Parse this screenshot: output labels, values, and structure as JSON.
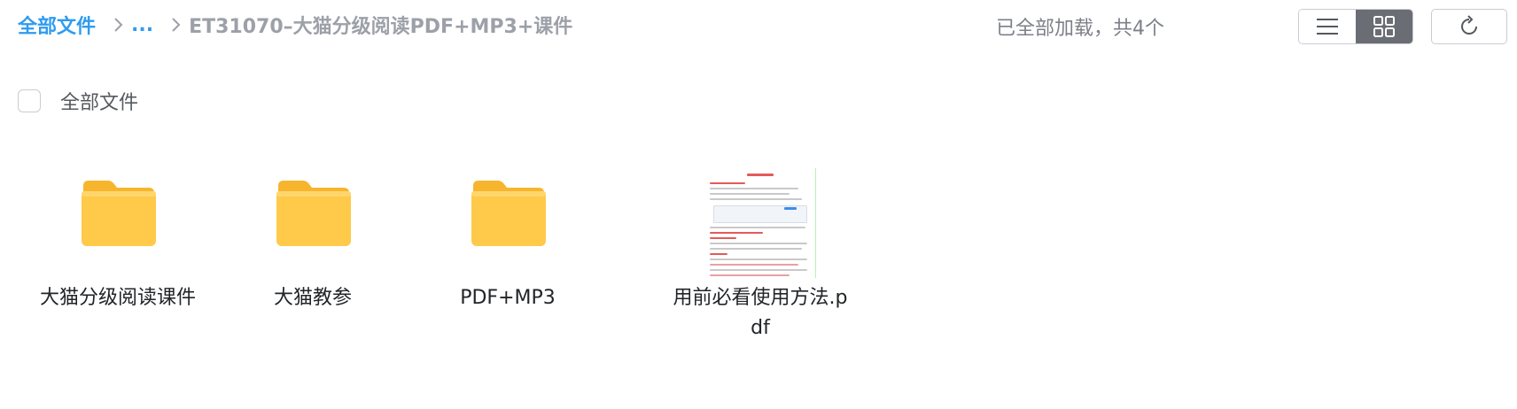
{
  "breadcrumb": {
    "root": "全部文件",
    "ellipsis": "...",
    "current": "ET31070–大猫分级阅读PDF+MP3+课件"
  },
  "status": {
    "load_text": "已全部加载，共4个"
  },
  "toolbar": {
    "list_view_icon": "list-icon",
    "grid_view_icon": "grid-icon",
    "active_view": "grid",
    "refresh_icon": "refresh-icon"
  },
  "select_all": {
    "label": "全部文件",
    "checked": false
  },
  "files": [
    {
      "name": "大猫分级阅读课件",
      "type": "folder",
      "icon": "folder-icon"
    },
    {
      "name": "大猫教参",
      "type": "folder",
      "icon": "folder-icon"
    },
    {
      "name": "PDF+MP3",
      "type": "folder",
      "icon": "folder-icon"
    },
    {
      "name": "用前必看使用方法.pdf",
      "type": "pdf",
      "icon": "pdf-thumbnail"
    }
  ],
  "colors": {
    "accent": "#2f9bf0",
    "muted_text": "#9ca0a8",
    "folder_body": "#ffc94a",
    "folder_tab": "#f7b52e",
    "active_toggle": "#6a6d73"
  }
}
